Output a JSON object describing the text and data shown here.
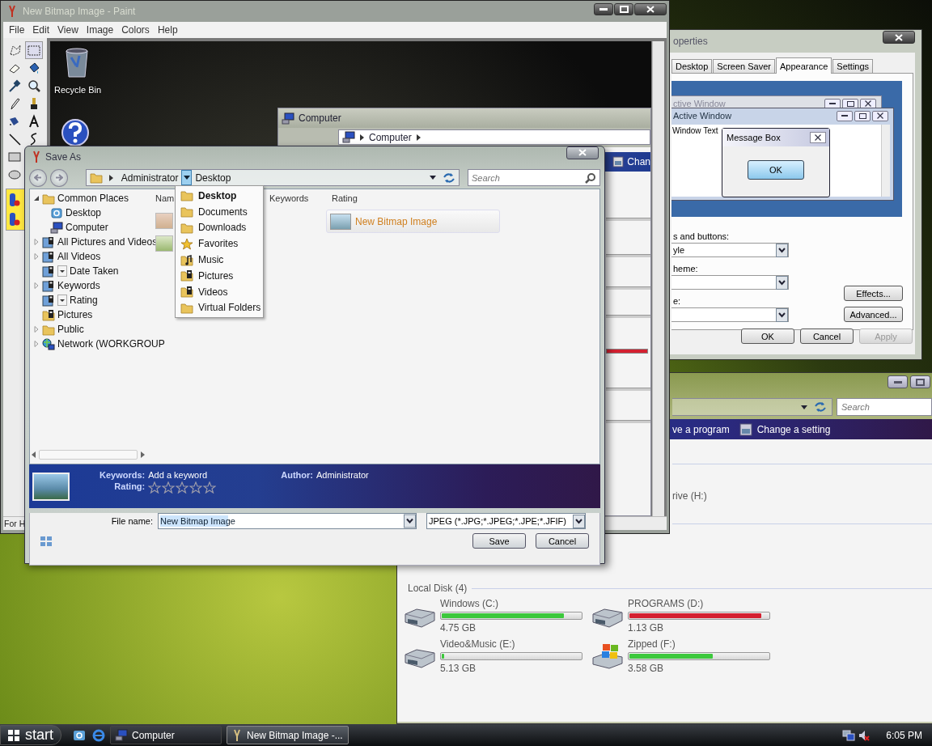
{
  "paint": {
    "title": "New Bitmap Image - Paint",
    "menu": [
      "File",
      "Edit",
      "View",
      "Image",
      "Colors",
      "Help"
    ],
    "canvas": {
      "icon_label": "Recycle Bin",
      "window_title": "Computer",
      "breadcrumb": "Computer",
      "command": "Chan"
    },
    "status": "For H"
  },
  "properties": {
    "title": "operties",
    "tabs": [
      {
        "label": "Desktop",
        "selected": false
      },
      {
        "label": "Screen Saver",
        "selected": false
      },
      {
        "label": "Appearance",
        "selected": true
      },
      {
        "label": "Settings",
        "selected": false
      }
    ],
    "preview": {
      "inactive_title": "ctive Window",
      "active_title": "Active Window",
      "window_text": "Window Text",
      "message_title": "Message Box",
      "message_button": "OK"
    },
    "fields": [
      {
        "label": "s and buttons:",
        "value": "yle"
      },
      {
        "label": "heme:"
      },
      {
        "label": "e:"
      }
    ],
    "side_buttons": [
      "Effects...",
      "Advanced..."
    ],
    "buttons": [
      {
        "label": "OK",
        "disabled": false
      },
      {
        "label": "Cancel",
        "disabled": false
      },
      {
        "label": "Apply",
        "disabled": true
      }
    ]
  },
  "explorer": {
    "search_placeholder": "Search",
    "commands": [
      "ve a program",
      "Change a setting"
    ],
    "partial_item": "rive (H:)",
    "group": "Local Disk (4)",
    "drives": [
      {
        "name": "Windows (C:)",
        "size": "4.75 GB",
        "level": 0.88,
        "color": "#3cc83c",
        "kind": "disk"
      },
      {
        "name": "PROGRAMS (D:)",
        "size": "1.13 GB",
        "level": 0.95,
        "color": "#d42030",
        "kind": "disk"
      },
      {
        "name": "Video&Music (E:)",
        "size": "5.13 GB",
        "level": 0.02,
        "color": "#3cc83c",
        "kind": "disk"
      },
      {
        "name": "Zipped (F:)",
        "size": "3.58 GB",
        "level": 0.6,
        "color": "#3cc83c",
        "kind": "system"
      }
    ]
  },
  "save_as": {
    "title": "Save As",
    "path": [
      "Administrator",
      "Desktop"
    ],
    "search_placeholder": "Search",
    "tree": [
      {
        "label": "Common Places",
        "kind": "folder",
        "expanded": true,
        "children": [
          {
            "label": "Desktop",
            "kind": "desktop"
          },
          {
            "label": "Computer",
            "kind": "computer"
          }
        ]
      },
      {
        "label": "All Pictures and Videos",
        "kind": "saved",
        "expanded": false
      },
      {
        "label": "All Videos",
        "kind": "saved",
        "expanded": false
      },
      {
        "label": "Date Taken",
        "kind": "filter"
      },
      {
        "label": "Keywords",
        "kind": "saved",
        "expanded": false
      },
      {
        "label": "Rating",
        "kind": "filter"
      },
      {
        "label": "Pictures",
        "kind": "media"
      },
      {
        "label": "Public",
        "kind": "folder",
        "expanded": false
      },
      {
        "label": "Network (WORKGROUP",
        "kind": "network",
        "expanded": false
      }
    ],
    "columns": [
      "Nam",
      "Keywords",
      "Rating"
    ],
    "files": [
      {
        "name": "New Bitmap Image"
      }
    ],
    "path_menu": [
      {
        "label": "Desktop",
        "kind": "folder",
        "selected": true
      },
      {
        "label": "Documents",
        "kind": "folder",
        "selected": false
      },
      {
        "label": "Downloads",
        "kind": "folder",
        "selected": false
      },
      {
        "label": "Favorites",
        "kind": "favorites",
        "selected": false
      },
      {
        "label": "Music",
        "kind": "music",
        "selected": false
      },
      {
        "label": "Pictures",
        "kind": "media",
        "selected": false
      },
      {
        "label": "Videos",
        "kind": "media",
        "selected": false
      },
      {
        "label": "Virtual Folders",
        "kind": "folder",
        "selected": false
      }
    ],
    "details": {
      "keywords_label": "Keywords:",
      "keywords": "Add a keyword",
      "rating_label": "Rating:",
      "stars": 0,
      "author_label": "Author:",
      "author": "Administrator"
    },
    "file_name_label": "File name:",
    "file_name": "New Bitmap Image",
    "file_type": "JPEG (*.JPG;*.JPEG;*.JPE;*.JFIF)",
    "buttons": [
      "Save",
      "Cancel"
    ]
  },
  "taskbar": {
    "start": "start",
    "buttons": [
      {
        "label": "Computer",
        "selected": false
      },
      {
        "label": "New Bitmap Image -...",
        "selected": true
      }
    ],
    "clock": "6:05 PM"
  }
}
